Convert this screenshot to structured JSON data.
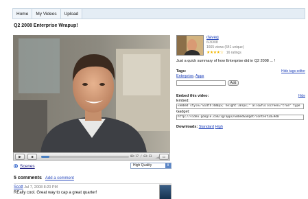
{
  "nav": {
    "tabs": [
      "Home",
      "My Videos",
      "Upload"
    ]
  },
  "page_title": "Q2 2008 Enterprise Wrapup!",
  "player": {
    "time_display": "00:17 / 03:13",
    "progress_fraction": 0.09
  },
  "scenes": {
    "label": "Scenes",
    "quality": "High Quality"
  },
  "comments": {
    "heading": "5 comments",
    "add_link": "Add a comment",
    "items": [
      {
        "author": "Scott",
        "date": "Jul 7, 2008 8:20 PM",
        "text": "REally cool. Great way to cap a great quarter!"
      }
    ]
  },
  "uploader": {
    "name": "daveg",
    "date": "6/30/08",
    "views": "1665 views (641 unique)",
    "stars": "★★★★☆",
    "ratings": "16 ratings"
  },
  "summary": "Just a quick summary of how Enterprise did in Q2 2008 ... !",
  "tags": {
    "label": "Tags:",
    "edit_link": "Hide tags editor",
    "items": [
      "Enterprise",
      "Apps"
    ],
    "add_button": "Add"
  },
  "embed": {
    "label": "Embed this video:",
    "hide_link": "Hide",
    "embed_label": "Embed:",
    "embed_code": "<embed style=\"width:480px; height:387px;\" allowfullscreen=\"true\" type",
    "gadget_label": "Gadget:",
    "gadget_code": "http://video.google.com/ig/apps/EmbedGadget?contentId=9d0"
  },
  "downloads": {
    "label": "Downloads:",
    "standard": "Standard",
    "high": "High"
  },
  "colors": {
    "link": "#2244bb",
    "nav_bg": "#e4edf5",
    "star": "#f2b600"
  }
}
